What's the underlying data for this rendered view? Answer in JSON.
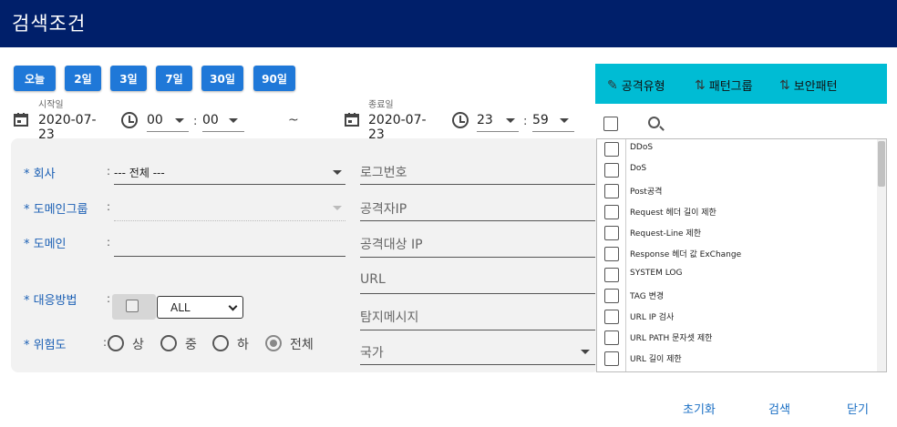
{
  "header": {
    "title": "검색조건"
  },
  "quick_ranges": [
    "오늘",
    "2일",
    "3일",
    "7일",
    "30일",
    "90일"
  ],
  "start": {
    "label": "시작일",
    "date": "2020-07-23",
    "hour": "00",
    "minute": "00"
  },
  "range_sep": "~",
  "end": {
    "label": "종료일",
    "date": "2020-07-23",
    "hour": "23",
    "minute": "59"
  },
  "fields": {
    "company": {
      "label": "* 회사",
      "value": "--- 전체 ---"
    },
    "domain_group": {
      "label": "* 도메인그룹",
      "value": ""
    },
    "domain": {
      "label": "* 도메인",
      "value": ""
    },
    "response": {
      "label": "* 대응방법",
      "select": "ALL"
    },
    "risk": {
      "label": "* 위험도",
      "options": [
        "상",
        "중",
        "하",
        "전체"
      ],
      "selected": "전체"
    }
  },
  "text_fields": {
    "log_no": "로그번호",
    "attacker_ip": "공격자IP",
    "target_ip": "공격대상 IP",
    "url": "URL",
    "detect_msg": "탐지메시지",
    "country": "국가"
  },
  "toolbar": {
    "attack_type": "공격유형",
    "pattern_group": "패턴그룹",
    "security_pattern": "보안패턴"
  },
  "attack_list": [
    "DDoS",
    "DoS",
    "Post공격",
    "Request 헤더 길이 제한",
    "Request-Line 제한",
    "Response 헤더 값 ExChange",
    "SYSTEM LOG",
    "TAG 변경",
    "URL IP 검사",
    "URL PATH 문자셋 제한",
    "URL 길이 제한"
  ],
  "actions": {
    "reset": "초기화",
    "search": "검색",
    "close": "닫기"
  },
  "colors": {
    "header": "#001f6a",
    "quick_button": "#1f78d8",
    "toolbar": "#00bcd4",
    "field_label": "#1a5fb4"
  }
}
